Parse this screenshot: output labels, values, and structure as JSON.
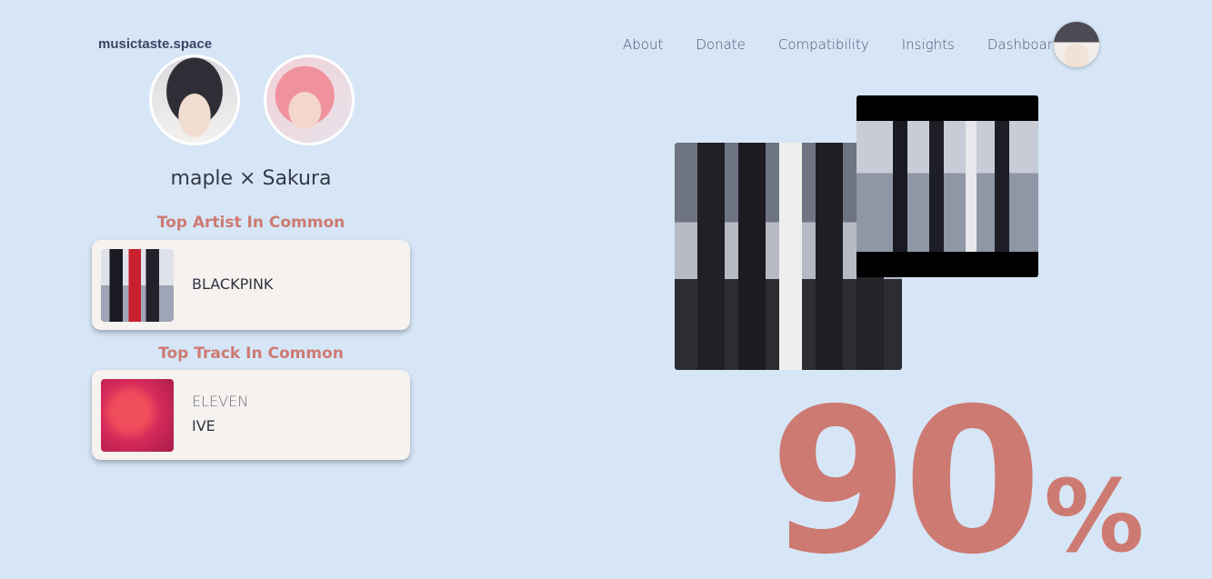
{
  "header": {
    "brand": "musictaste.space",
    "nav": [
      "About",
      "Donate",
      "Compatibility",
      "Insights",
      "Dashboard"
    ]
  },
  "comparison": {
    "user_a": "maple",
    "separator": "×",
    "user_b": "Sakura",
    "title": "maple × Sakura"
  },
  "top_artist": {
    "heading": "Top Artist In Common",
    "name": "BLACKPINK"
  },
  "top_track": {
    "heading": "Top Track In Common",
    "title": "ELEVEN",
    "artist": "IVE"
  },
  "score": {
    "value": "90",
    "unit": "%"
  },
  "colors": {
    "background": "#d6e6f6",
    "accent": "#cd7a72",
    "card": "#f6f2ef"
  }
}
